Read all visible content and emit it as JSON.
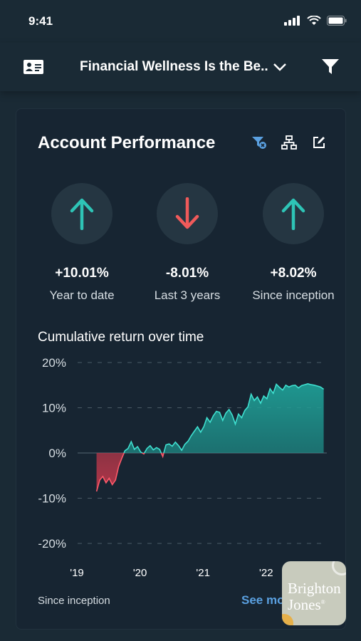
{
  "status_bar": {
    "time": "9:41"
  },
  "nav": {
    "title": "Financial Wellness Is the Be..",
    "icons": [
      "contact-card-icon",
      "chevron-down-icon",
      "filter-icon"
    ]
  },
  "card": {
    "title": "Account Performance",
    "tool_icons": [
      "filter-clear-icon",
      "hierarchy-icon",
      "edit-icon"
    ],
    "metrics": [
      {
        "value": "+10.01%",
        "label": "Year to date",
        "direction": "up",
        "color": "#2ec4b6"
      },
      {
        "value": "-8.01%",
        "label": "Last 3 years",
        "direction": "down",
        "color": "#f05a5a"
      },
      {
        "value": "+8.02%",
        "label": "Since inception",
        "direction": "up",
        "color": "#2ec4b6"
      }
    ],
    "chart_title": "Cumulative return over time",
    "footer_left": "Since inception",
    "footer_link": "See mo"
  },
  "chart_data": {
    "type": "area",
    "title": "Cumulative return over time",
    "xlabel": "",
    "ylabel": "",
    "x_tick_labels": [
      "'19",
      "'20",
      "'21",
      "'22"
    ],
    "y_tick_labels": [
      "20%",
      "10%",
      "0%",
      "-10%",
      "-20%"
    ],
    "ylim": [
      -20,
      20
    ],
    "grid": true,
    "x_range": [
      2019.0,
      2022.95
    ],
    "series": [
      {
        "x": [
          2019.3,
          2019.35,
          2019.4,
          2019.45,
          2019.5,
          2019.55,
          2019.6,
          2019.65,
          2019.7,
          2019.75,
          2019.8,
          2019.85,
          2019.9,
          2019.95,
          2020.0,
          2020.05,
          2020.1,
          2020.15,
          2020.2,
          2020.25,
          2020.3,
          2020.35,
          2020.4,
          2020.45,
          2020.5,
          2020.55,
          2020.6,
          2020.65,
          2020.7,
          2020.75,
          2020.8,
          2020.85,
          2020.9,
          2020.95,
          2021.0,
          2021.05,
          2021.1,
          2021.15,
          2021.2,
          2021.25,
          2021.3,
          2021.35,
          2021.4,
          2021.45,
          2021.5,
          2021.55,
          2021.6,
          2021.65,
          2021.7,
          2021.75,
          2021.8,
          2021.85,
          2021.9,
          2021.95,
          2022.0,
          2022.05,
          2022.1,
          2022.15,
          2022.2,
          2022.25,
          2022.3,
          2022.35,
          2022.4,
          2022.45,
          2022.5,
          2022.55,
          2022.6,
          2022.65,
          2022.7,
          2022.75,
          2022.8,
          2022.85,
          2022.9
        ],
        "y": [
          -8.5,
          -6.0,
          -5.2,
          -6.6,
          -5.6,
          -7.0,
          -6.0,
          -3.0,
          -1.2,
          0.5,
          1.0,
          2.5,
          0.8,
          1.4,
          0.2,
          -0.2,
          1.0,
          1.6,
          0.7,
          1.2,
          0.8,
          -0.8,
          1.8,
          2.0,
          1.5,
          2.4,
          1.6,
          0.6,
          1.9,
          2.6,
          3.8,
          4.8,
          5.8,
          4.6,
          5.8,
          7.8,
          6.8,
          8.2,
          9.2,
          9.0,
          7.2,
          8.8,
          9.6,
          8.4,
          6.4,
          8.6,
          7.8,
          9.4,
          10.2,
          13.0,
          11.6,
          12.4,
          11.0,
          12.6,
          12.0,
          14.2,
          13.2,
          15.2,
          14.5,
          13.9,
          15.0,
          14.6,
          14.9,
          15.0,
          14.4,
          14.9,
          15.1,
          15.3,
          15.1,
          15.0,
          14.8,
          14.6,
          14.1
        ]
      }
    ],
    "colors": {
      "positive": "#1f9c94",
      "negative": "#c0384b",
      "grid": "#4a5a66"
    }
  }
}
